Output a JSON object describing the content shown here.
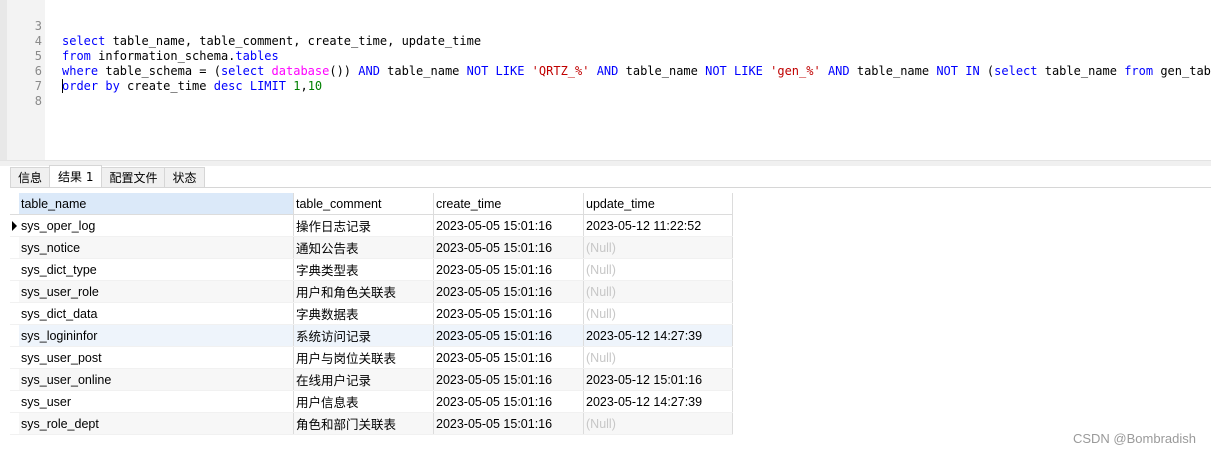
{
  "editor": {
    "lines": [
      {
        "num": "3",
        "text": "select table_name, table_comment, create_time, update_time"
      },
      {
        "num": "4",
        "text": "from information_schema.tables"
      },
      {
        "num": "5",
        "text": "where table_schema = (select database()) AND table_name NOT LIKE 'QRTZ_%' AND table_name NOT LIKE 'gen_%' AND table_name NOT IN (select table_name from gen_table)"
      },
      {
        "num": "6",
        "text": "order by create_time desc LIMIT 1,10"
      },
      {
        "num": "7",
        "text": ""
      },
      {
        "num": "8",
        "text": ""
      }
    ],
    "line_numbers": [
      "3",
      "4",
      "5",
      "6",
      "7",
      "8"
    ],
    "tokens": {
      "l3": {
        "select": "select",
        "rest": " table_name, table_comment, create_time, update_time"
      },
      "l4": {
        "from": "from",
        "schema": " information_schema.",
        "tables": "tables"
      },
      "l5": {
        "where": "where",
        "a": " table_schema = (",
        "select": "select",
        "sp": " ",
        "database": "database",
        "b": "()) ",
        "and1": "AND",
        "c": " table_name ",
        "notlike1": "NOT LIKE",
        "sp2": " ",
        "str1": "'QRTZ_%'",
        "sp3": " ",
        "and2": "AND",
        "d": " table_name ",
        "notlike2": "NOT LIKE",
        "sp4": " ",
        "str2": "'gen_%'",
        "sp5": " ",
        "and3": "AND",
        "e": " table_name ",
        "notin": "NOT IN",
        "f": " (",
        "select2": "select",
        "g": " table_name ",
        "from": "from",
        "h": " gen_table)"
      },
      "l6": {
        "orderby": "order by",
        "a": " create_time ",
        "desc": "desc",
        "sp": " ",
        "limit": "LIMIT",
        "sp2": " ",
        "n1": "1",
        "comma": ",",
        "n2": "10"
      }
    }
  },
  "tabs": [
    {
      "label": "信息"
    },
    {
      "label": "结果 1"
    },
    {
      "label": "配置文件"
    },
    {
      "label": "状态"
    }
  ],
  "active_tab": "结果 1",
  "grid": {
    "columns": [
      "table_name",
      "table_comment",
      "create_time",
      "update_time"
    ],
    "rows": [
      [
        "sys_oper_log",
        "操作日志记录",
        "2023-05-05 15:01:16",
        "2023-05-12 11:22:52"
      ],
      [
        "sys_notice",
        "通知公告表",
        "2023-05-05 15:01:16",
        "(Null)"
      ],
      [
        "sys_dict_type",
        "字典类型表",
        "2023-05-05 15:01:16",
        "(Null)"
      ],
      [
        "sys_user_role",
        "用户和角色关联表",
        "2023-05-05 15:01:16",
        "(Null)"
      ],
      [
        "sys_dict_data",
        "字典数据表",
        "2023-05-05 15:01:16",
        "(Null)"
      ],
      [
        "sys_logininfor",
        "系统访问记录",
        "2023-05-05 15:01:16",
        "2023-05-12 14:27:39"
      ],
      [
        "sys_user_post",
        "用户与岗位关联表",
        "2023-05-05 15:01:16",
        "(Null)"
      ],
      [
        "sys_user_online",
        "在线用户记录",
        "2023-05-05 15:01:16",
        "2023-05-12 15:01:16"
      ],
      [
        "sys_user",
        "用户信息表",
        "2023-05-05 15:01:16",
        "2023-05-12 14:27:39"
      ],
      [
        "sys_role_dept",
        "角色和部门关联表",
        "2023-05-05 15:01:16",
        "(Null)"
      ]
    ]
  },
  "watermark": "CSDN @Bombradish",
  "colors": {
    "keyword": "#0000ff",
    "function": "#ff00ff",
    "string": "#c00000",
    "number": "#008000",
    "null": "#c7c7c7",
    "selected_header": "#dbe9f9"
  }
}
